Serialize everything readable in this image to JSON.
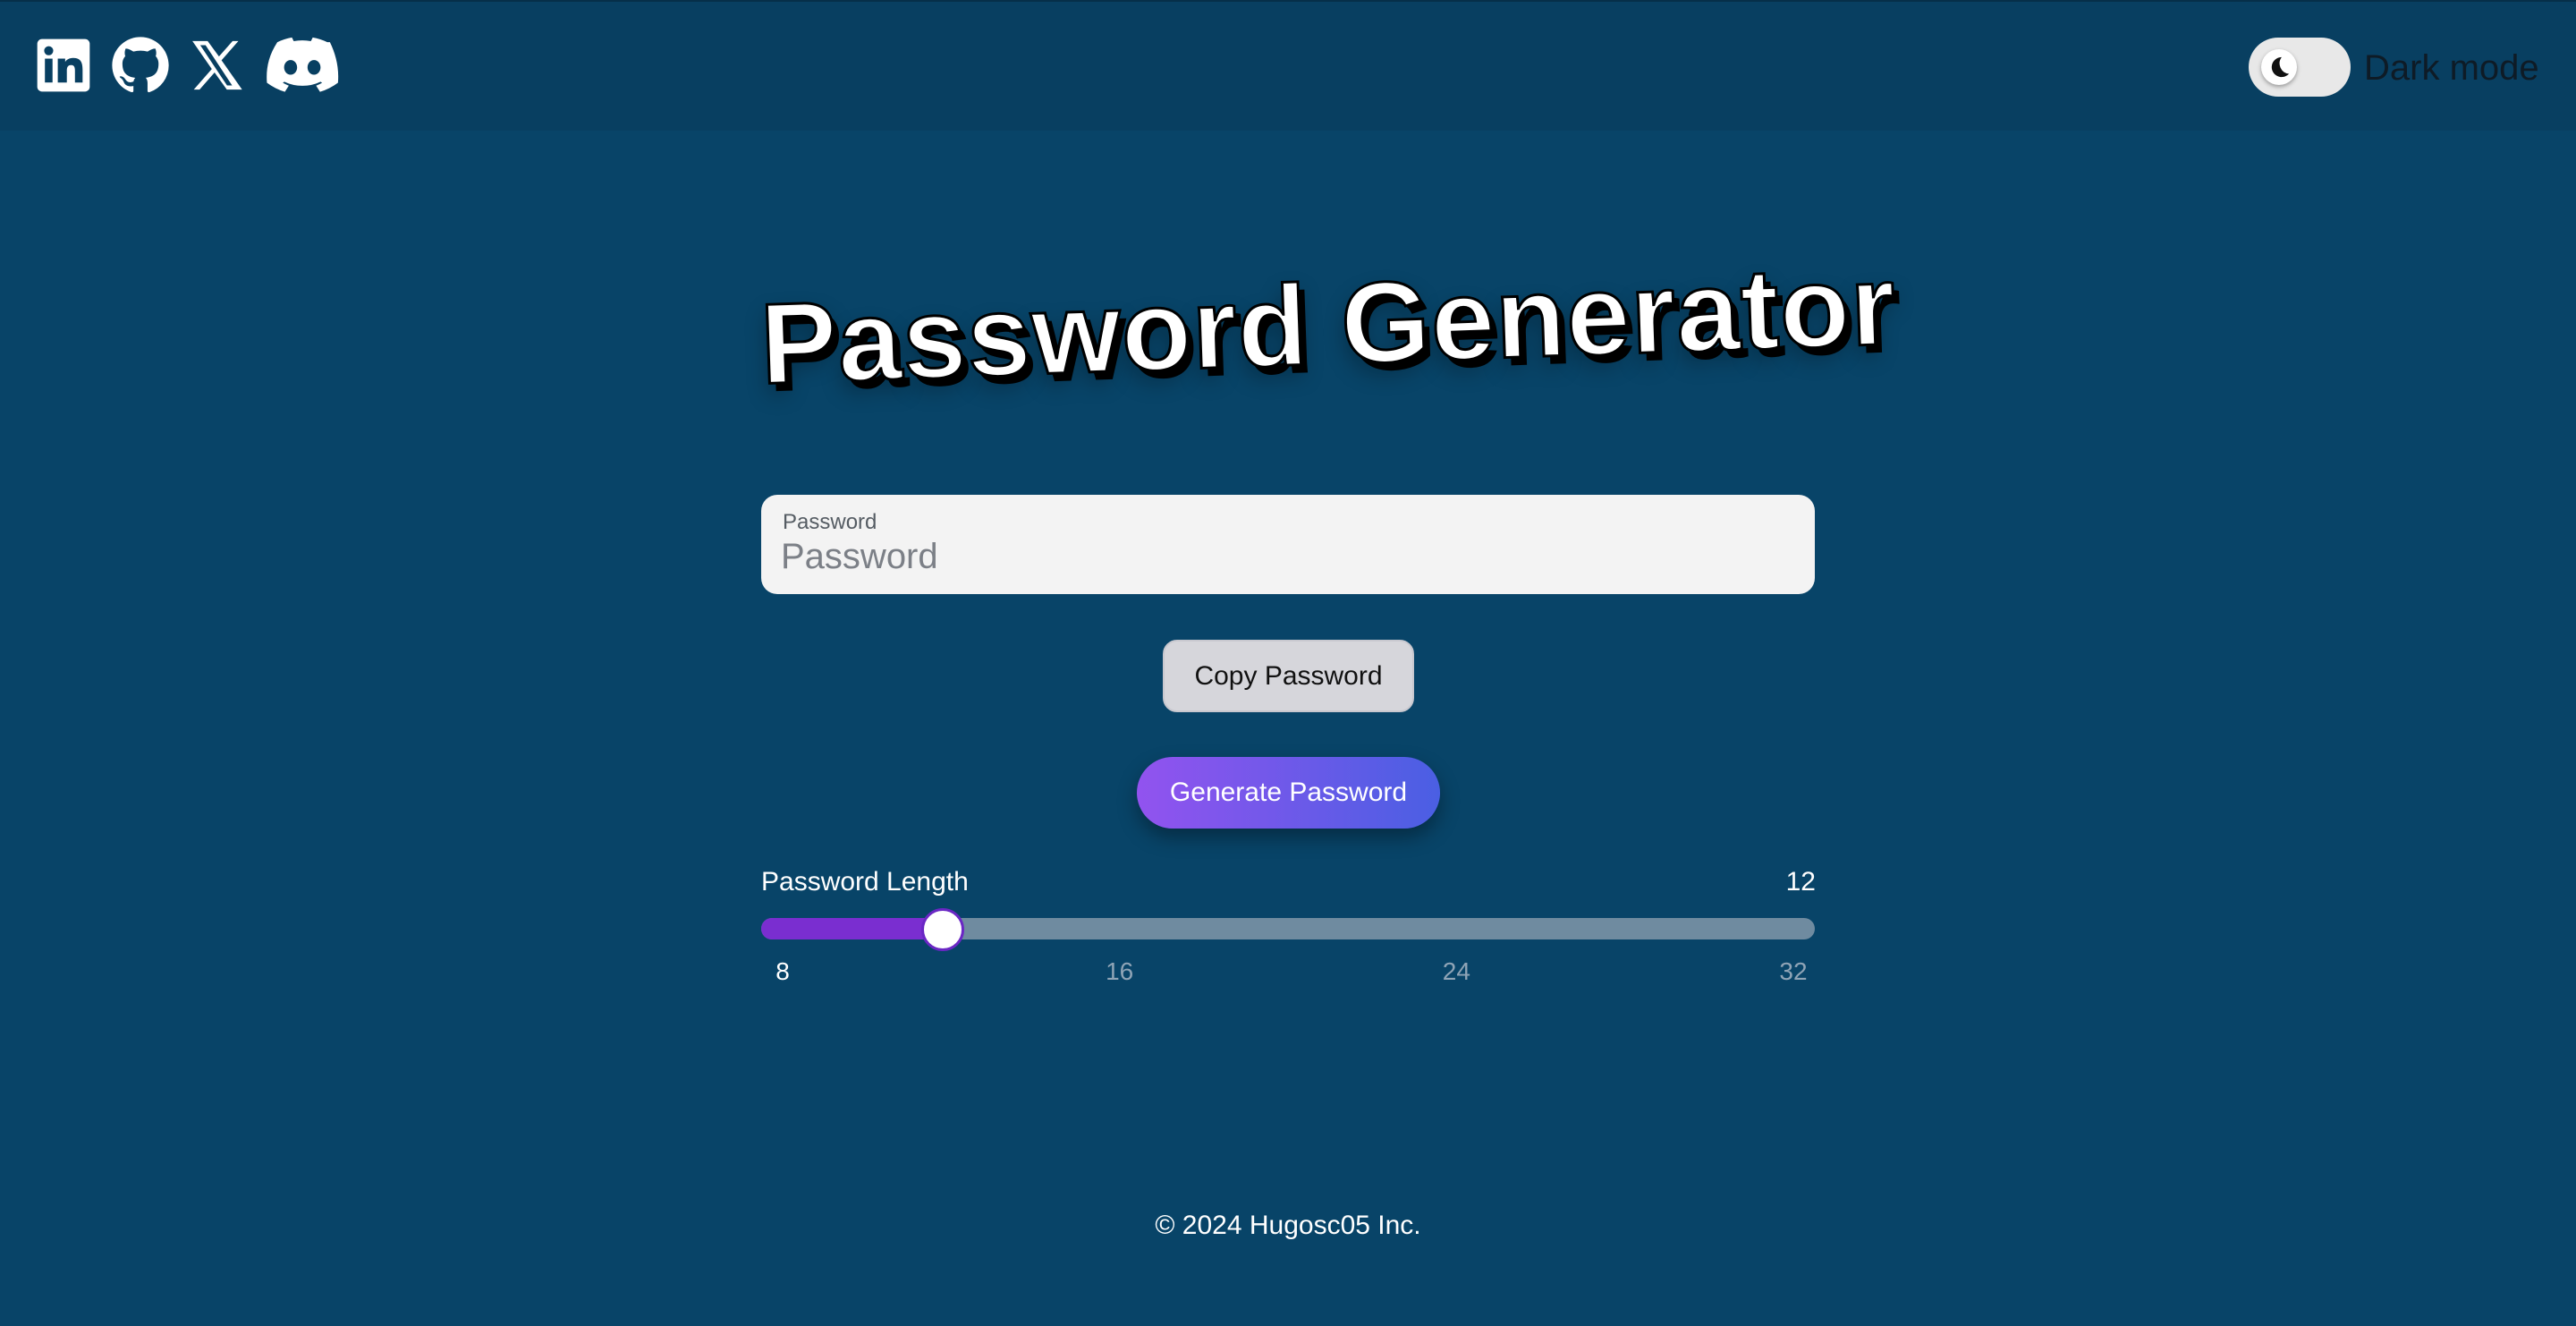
{
  "header": {
    "socials": [
      {
        "name": "LinkedIn",
        "icon": "linkedin-icon"
      },
      {
        "name": "GitHub",
        "icon": "github-icon"
      },
      {
        "name": "X",
        "icon": "x-icon"
      },
      {
        "name": "Discord",
        "icon": "discord-icon"
      }
    ],
    "theme_toggle": {
      "label": "Dark mode",
      "icon": "moon-icon",
      "checked": false
    }
  },
  "title": "Password Generator",
  "password_field": {
    "label": "Password",
    "placeholder": "Password",
    "value": ""
  },
  "buttons": {
    "copy_label": "Copy Password",
    "generate_label": "Generate Password"
  },
  "length": {
    "label": "Password Length",
    "value": "12",
    "min": 8,
    "max": 32,
    "current": 12,
    "ticks": [
      "8",
      "16",
      "24",
      "32"
    ]
  },
  "footer": {
    "text": "© 2024 Hugosc05 Inc."
  },
  "colors": {
    "background": "#084468",
    "header": "#083f61",
    "accent_purple": "#7a2ed0",
    "generate_gradient_start": "#9253ef",
    "generate_gradient_end": "#4a5fe3"
  }
}
